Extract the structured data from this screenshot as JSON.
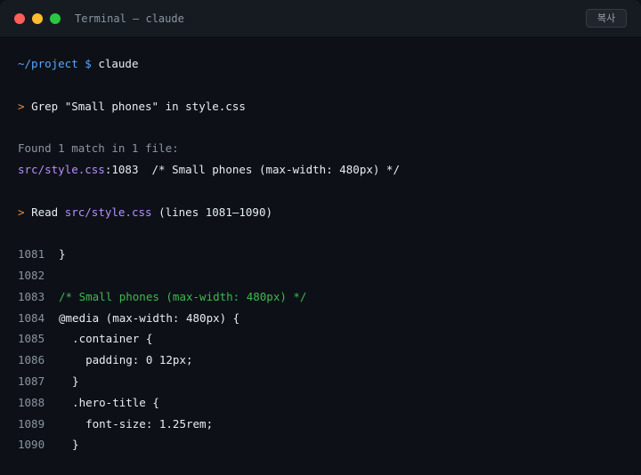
{
  "window": {
    "title": "Terminal — claude",
    "copy_label": "복사"
  },
  "terminal": {
    "prompt_path": "~/project",
    "prompt_symbol": "$",
    "command": "claude",
    "grep": {
      "marker": ">",
      "text": "Grep \"Small phones\" in style.css"
    },
    "found": "Found 1 match in 1 file:",
    "match": {
      "file": "src/style.css",
      "line": ":1083",
      "text": "  /* Small phones (max-width: 480px) */"
    },
    "read": {
      "marker": ">",
      "label": "Read ",
      "file": "src/style.css",
      "range": " (lines 1081–1090)"
    },
    "code_lines": [
      {
        "num": "1081",
        "text": "}"
      },
      {
        "num": "1082",
        "text": ""
      },
      {
        "num": "1083",
        "text": "/* Small phones (max-width: 480px) */"
      },
      {
        "num": "1084",
        "text": "@media (max-width: 480px) {"
      },
      {
        "num": "1085",
        "text": "  .container {"
      },
      {
        "num": "1086",
        "text": "    padding: 0 12px;"
      },
      {
        "num": "1087",
        "text": "  }"
      },
      {
        "num": "1088",
        "text": "  .hero-title {"
      },
      {
        "num": "1089",
        "text": "    font-size: 1.25rem;"
      },
      {
        "num": "1090",
        "text": "  }"
      }
    ]
  }
}
